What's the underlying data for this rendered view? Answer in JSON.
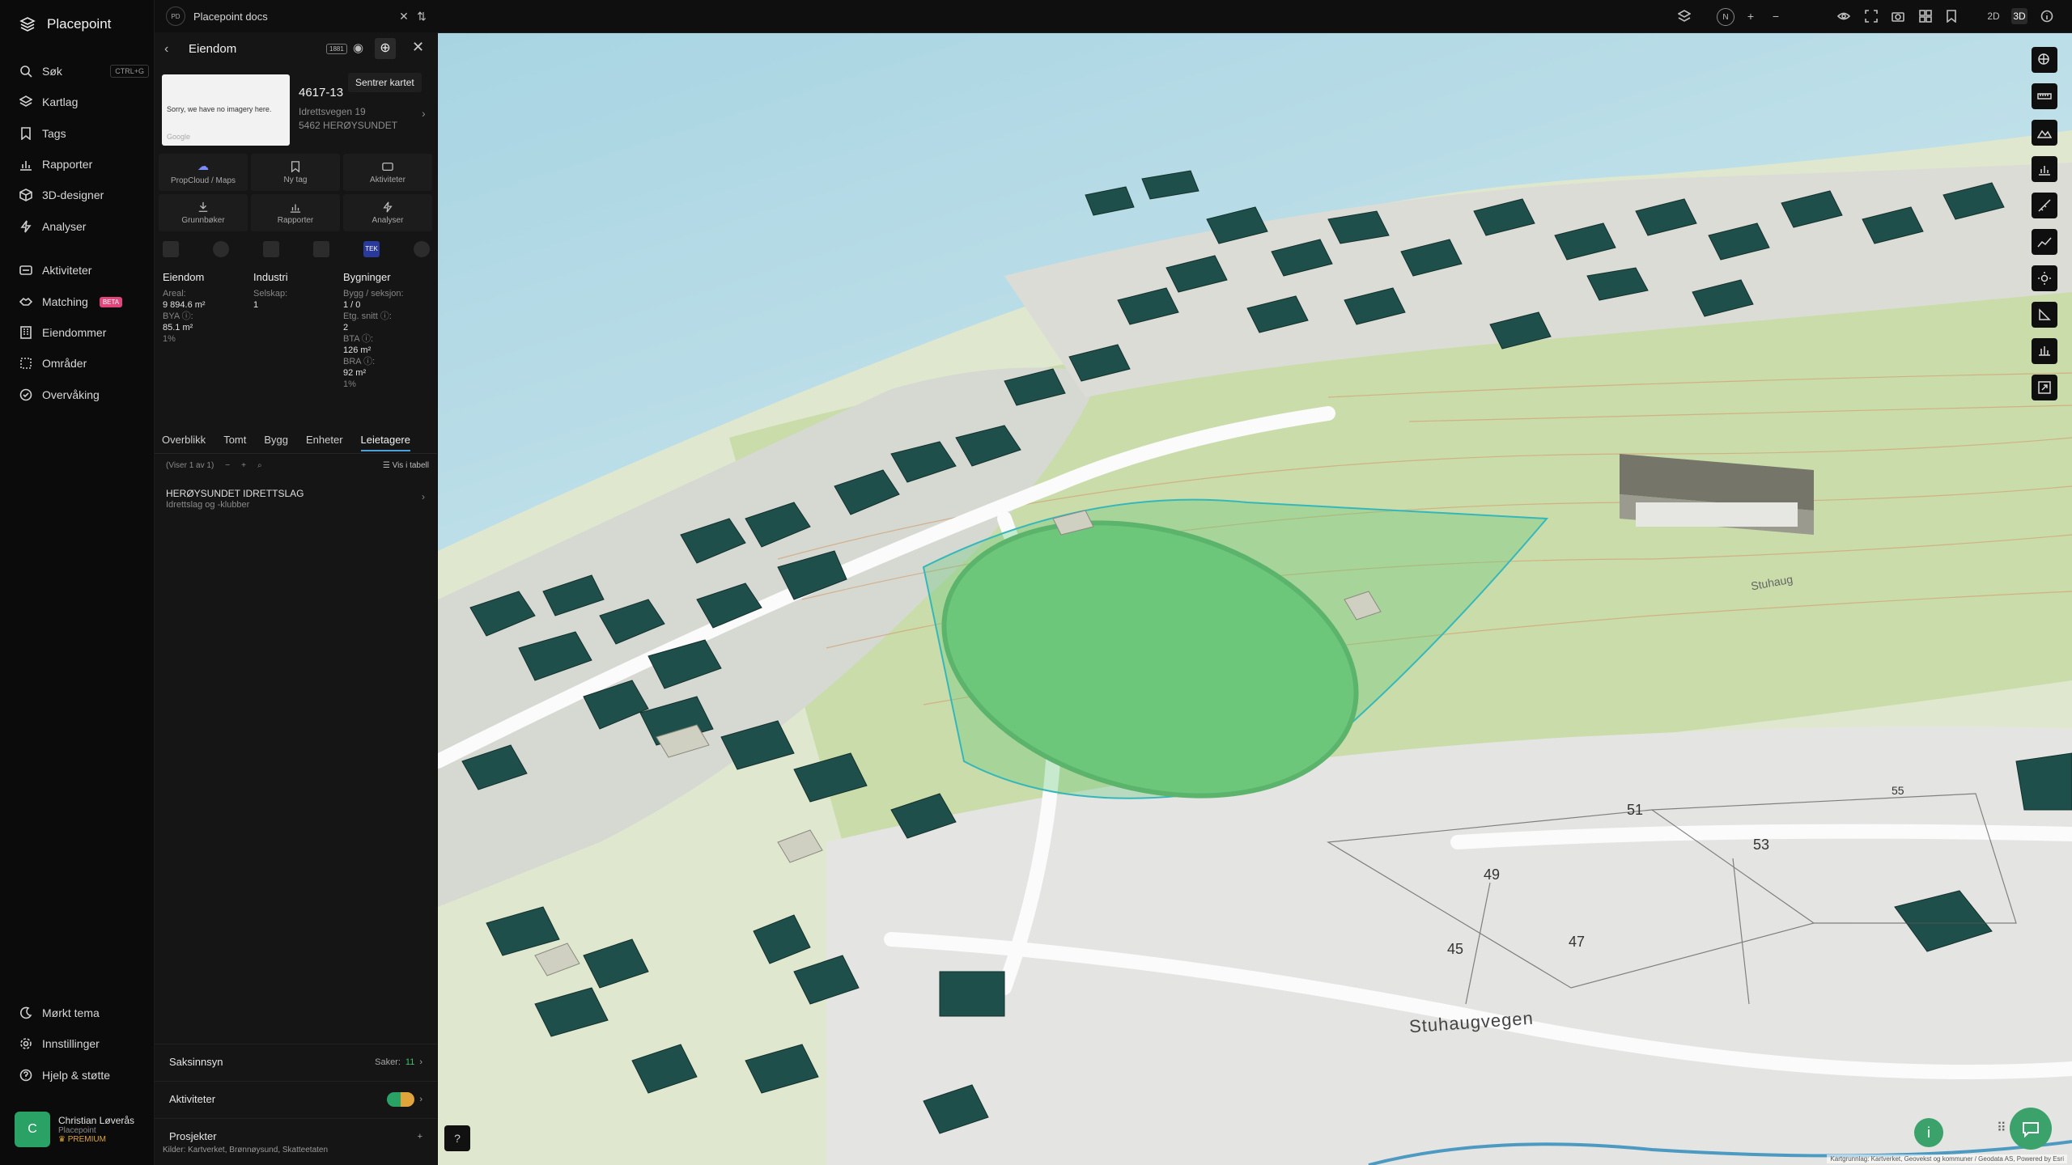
{
  "app": {
    "name": "Placepoint"
  },
  "nav": {
    "search": "Søk",
    "shortcut": "CTRL+G",
    "items": [
      "Kartlag",
      "Tags",
      "Rapporter",
      "3D-designer",
      "Analyser",
      "Aktiviteter",
      "Matching",
      "Eiendommer",
      "Områder",
      "Overvåking"
    ],
    "beta": "BETA",
    "bottom": [
      "Mørkt tema",
      "Innstillinger",
      "Hjelp & støtte"
    ]
  },
  "user": {
    "initial": "C",
    "name": "Christian Løverås",
    "org": "Placepoint",
    "tier": "PREMIUM"
  },
  "topbar": {
    "doc_initials": "PD",
    "doc_title": "Placepoint docs",
    "compass": "N",
    "mode2d": "2D",
    "mode3d": "3D"
  },
  "panel": {
    "title": "Eiendom",
    "badge": "1881",
    "tooltip": "Sentrer kartet",
    "thumb_text": "Sorry, we have no imagery here.",
    "thumb_brand": "Google",
    "property_id": "4617-13",
    "address_line1": "Idrettsvegen 19",
    "address_line2": "5462 HERØYSUNDET",
    "actions": [
      "PropCloud / Maps",
      "Ny tag",
      "Aktiviteter",
      "Grunnbøker",
      "Rapporter",
      "Analyser"
    ],
    "tek": "TEK",
    "stats": {
      "eiendom": {
        "heading": "Eiendom",
        "areal_label": "Areal:",
        "areal_value": "9 894.6 m²",
        "bya_label": "BYA ⓘ:",
        "bya_value": "85.1 m²",
        "bya_pct": "1%"
      },
      "industri": {
        "heading": "Industri",
        "selskap_label": "Selskap:",
        "selskap_value": "1"
      },
      "bygninger": {
        "heading": "Bygninger",
        "bygg_label": "Bygg / seksjon:",
        "bygg_value": "1 / 0",
        "etg_label": "Etg. snitt ⓘ:",
        "etg_value": "2",
        "bta_label": "BTA ⓘ:",
        "bta_value": "126 m²",
        "bra_label": "BRA ⓘ:",
        "bra_value": "92 m²",
        "bra_pct": "1%"
      }
    },
    "tabs": [
      "Overblikk",
      "Tomt",
      "Bygg",
      "Enheter",
      "Leietagere"
    ],
    "active_tab": "Leietagere",
    "list_count": "(Viser 1 av 1)",
    "table_toggle": "Vis i tabell",
    "tenant": {
      "name": "HERØYSUNDET IDRETTSLAG",
      "type": "Idrettslag og -klubber"
    },
    "sections": {
      "saksinnsyn": "Saksinnsyn",
      "saker_label": "Saker:",
      "saker_value": "11",
      "aktiviteter": "Aktiviteter",
      "prosjekter": "Prosjekter"
    },
    "sources_label": "Kilder:",
    "sources": [
      "Kartverket",
      "Brønnøysund",
      "Skatteetaten"
    ]
  },
  "map": {
    "plot_numbers": [
      "51",
      "53",
      "49",
      "47",
      "45",
      "55"
    ],
    "road_name": "Stuhaugvegen",
    "area_name": "Stuhaug",
    "attribution": "Kartgrunnlag: Kartverket, Geovekst og kommuner / Geodata AS, Powered by Esri"
  }
}
